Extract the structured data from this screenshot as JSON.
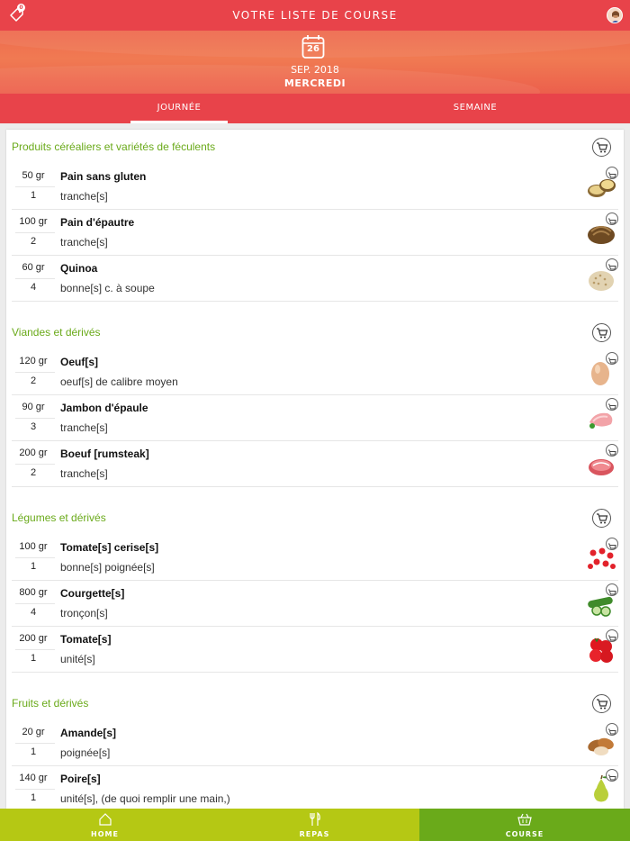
{
  "header": {
    "title": "VOTRE LISTE DE COURSE",
    "badge_count": "0",
    "calendar_day": "26",
    "month_year": "SEP. 2018",
    "weekday": "MERCREDI"
  },
  "tabs": [
    {
      "label": "JOURNÉE",
      "active": true
    },
    {
      "label": "SEMAINE",
      "active": false
    }
  ],
  "sections": [
    {
      "title": "Produits céréaliers et variétés de féculents",
      "items": [
        {
          "qty": "50 gr",
          "count": "1",
          "name": "Pain sans gluten",
          "unit": "tranche[s]",
          "icon": "bread-icon"
        },
        {
          "qty": "100 gr",
          "count": "2",
          "name": "Pain d'épautre",
          "unit": "tranche[s]",
          "icon": "bread-loaf-icon"
        },
        {
          "qty": "60 gr",
          "count": "4",
          "name": "Quinoa",
          "unit": "bonne[s] c. à soupe",
          "icon": "quinoa-icon"
        }
      ]
    },
    {
      "title": "Viandes et dérivés",
      "items": [
        {
          "qty": "120 gr",
          "count": "2",
          "name": "Oeuf[s]",
          "unit": "oeuf[s] de calibre moyen",
          "icon": "egg-icon"
        },
        {
          "qty": "90 gr",
          "count": "3",
          "name": "Jambon d'épaule",
          "unit": "tranche[s]",
          "icon": "ham-icon"
        },
        {
          "qty": "200 gr",
          "count": "2",
          "name": "Boeuf [rumsteak]",
          "unit": "tranche[s]",
          "icon": "beef-icon"
        }
      ]
    },
    {
      "title": "Légumes et dérivés",
      "items": [
        {
          "qty": "100 gr",
          "count": "1",
          "name": "Tomate[s] cerise[s]",
          "unit": "bonne[s] poignée[s]",
          "icon": "cherry-tomato-icon"
        },
        {
          "qty": "800 gr",
          "count": "4",
          "name": "Courgette[s]",
          "unit": "tronçon[s]",
          "icon": "zucchini-icon"
        },
        {
          "qty": "200 gr",
          "count": "1",
          "name": "Tomate[s]",
          "unit": "unité[s]",
          "icon": "tomato-icon"
        }
      ]
    },
    {
      "title": "Fruits et dérivés",
      "items": [
        {
          "qty": "20 gr",
          "count": "1",
          "name": "Amande[s]",
          "unit": "poignée[s]",
          "icon": "almond-icon"
        },
        {
          "qty": "140 gr",
          "count": "1",
          "name": "Poire[s]",
          "unit": "unité[s], (de quoi remplir une main,)",
          "icon": "pear-icon"
        }
      ]
    }
  ],
  "bottom_nav": [
    {
      "label": "HOME",
      "icon": "home-icon",
      "active": false
    },
    {
      "label": "REPAS",
      "icon": "fork-knife-icon",
      "active": false
    },
    {
      "label": "COURSE",
      "icon": "basket-icon",
      "active": true
    }
  ],
  "colors": {
    "header_red": "#e8434a",
    "band_orange": "#f07a52",
    "section_green": "#6aaa1a",
    "nav_lime": "#b5c814",
    "nav_active": "#6aaa1a"
  }
}
